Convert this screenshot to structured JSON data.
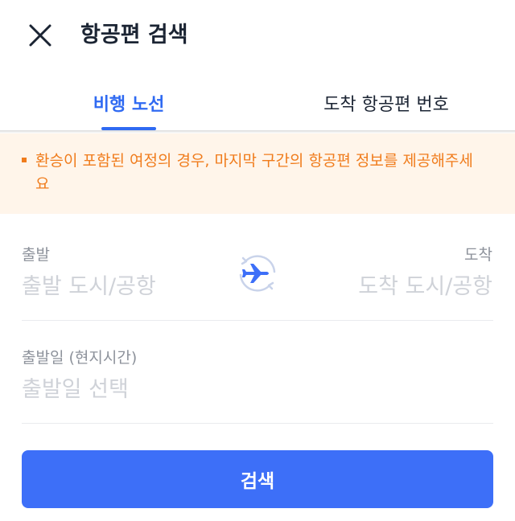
{
  "header": {
    "title": "항공편 검색",
    "close_icon": "close-icon"
  },
  "tabs": [
    {
      "label": "비행 노선",
      "active": true
    },
    {
      "label": "도착 항공편 번호",
      "active": false
    }
  ],
  "notice": {
    "text": "환승이 포함된 여정의 경우, 마지막 구간의 항공편 정보를 제공해주세요"
  },
  "form": {
    "departure": {
      "label": "출발",
      "placeholder": "출발 도시/공항"
    },
    "arrival": {
      "label": "도착",
      "placeholder": "도착 도시/공항"
    },
    "swap_icon": "airplane-swap-icon",
    "date": {
      "label": "출발일 (현지시간)",
      "placeholder": "출발일 선택"
    }
  },
  "search_button": {
    "label": "검색"
  },
  "colors": {
    "accent": "#2f6af2",
    "button": "#3d6ff8",
    "notice_bg": "#fff5ea",
    "notice_text": "#f07c1c",
    "placeholder": "#cfd2d8",
    "label": "#8d929b"
  }
}
